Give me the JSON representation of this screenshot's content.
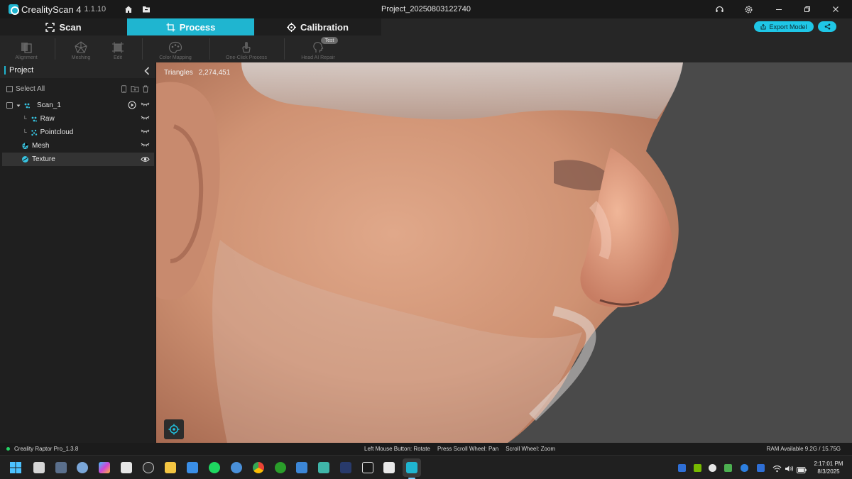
{
  "window": {
    "app_name": "CrealityScan 4",
    "app_version": "1.1.10",
    "document_title": "Project_20250803122740"
  },
  "tabs": [
    {
      "label": "Scan",
      "active": false
    },
    {
      "label": "Process",
      "active": true
    },
    {
      "label": "Calibration",
      "active": false
    }
  ],
  "actions": {
    "export_label": "Export Model"
  },
  "toolbar": {
    "alignment": "Alignment",
    "meshing": "Meshing",
    "edit": "Edit",
    "color_mapping": "Color Mapping",
    "one_click": "One-Click Process",
    "head_repair": "Head AI Repair",
    "test_badge": "Test"
  },
  "sidebar": {
    "title": "Project",
    "select_all": "Select All",
    "tree": [
      {
        "label": "Scan_1"
      },
      {
        "label": "Raw"
      },
      {
        "label": "Pointcloud"
      },
      {
        "label": "Mesh"
      },
      {
        "label": "Texture"
      }
    ]
  },
  "viewport": {
    "triangles_label": "Triangles",
    "triangles_value": "2,274,451"
  },
  "statusbar": {
    "engine": "Creality Raptor Pro_1.3.8",
    "hint_rotate": "Left Mouse Button: Rotate",
    "hint_pan": "Press Scroll Wheel: Pan",
    "hint_zoom": "Scroll Wheel: Zoom",
    "ram": "RAM Available 9.2G / 15.75G"
  },
  "clock": {
    "time": "2:17:01 PM",
    "date": "8/3/2025"
  },
  "colors": {
    "accent": "#1fb5d0",
    "export": "#1fc6e6",
    "status_ok": "#25d366"
  }
}
